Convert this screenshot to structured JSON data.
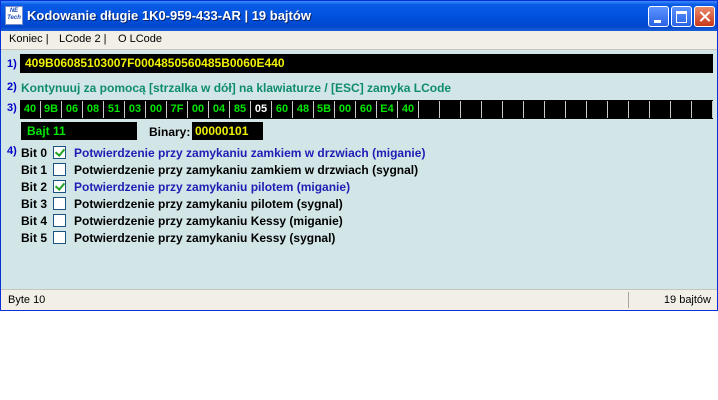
{
  "window": {
    "title": "Kodowanie długie   1K0-959-433-AR  |  19 bajtów",
    "logo_text": "NE Tech"
  },
  "menu": {
    "items": [
      {
        "label": "Koniec |"
      },
      {
        "label": "LCode 2 |"
      },
      {
        "label": "O LCode"
      }
    ]
  },
  "step_numbers": [
    "1)",
    "2)",
    "3)",
    "4)"
  ],
  "coding": {
    "long_code": "409B06085103007F0004850560485B0060E440",
    "hint": "Kontynuuj za pomocą [strzalka w dół] na klawiaturze / [ESC] zamyka LCode",
    "bytes": [
      "40",
      "9B",
      "06",
      "08",
      "51",
      "03",
      "00",
      "7F",
      "00",
      "04",
      "85",
      "05",
      "60",
      "48",
      "5B",
      "00",
      "60",
      "E4",
      "40"
    ],
    "selected_byte_index": 11,
    "total_cells": 33,
    "byte_label": "Bajt 11",
    "binary_label": "Binary:",
    "binary_value": "00000101"
  },
  "bits": [
    {
      "label": "Bit 0",
      "checked": true,
      "desc": "Potwierdzenie przy zamykaniu zamkiem w drzwiach (miganie)"
    },
    {
      "label": "Bit 1",
      "checked": false,
      "desc": "Potwierdzenie przy zamykaniu zamkiem w drzwiach (sygnal)"
    },
    {
      "label": "Bit 2",
      "checked": true,
      "desc": "Potwierdzenie przy zamykaniu pilotem (miganie)"
    },
    {
      "label": "Bit 3",
      "checked": false,
      "desc": "Potwierdzenie przy zamykaniu pilotem (sygnal)"
    },
    {
      "label": "Bit 4",
      "checked": false,
      "desc": "Potwierdzenie przy zamykaniu Kessy (miganie)"
    },
    {
      "label": "Bit 5",
      "checked": false,
      "desc": "Potwierdzenie przy zamykaniu Kessy (sygnal)"
    }
  ],
  "status": {
    "left": "Byte 10",
    "right": "19 bajtów"
  },
  "colors": {
    "titlebar": "#0052e0",
    "field_bg": "#000000",
    "code_text": "#f0f000",
    "byte_text": "#00e600",
    "hint_text": "#0f8c6e",
    "checked_desc": "#1e1eb4",
    "window_bg": "#d2e5e7"
  }
}
